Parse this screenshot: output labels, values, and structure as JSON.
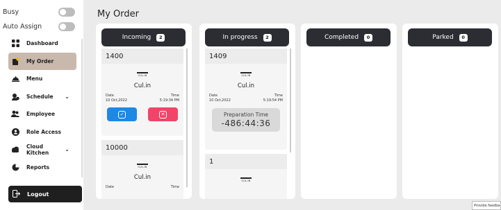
{
  "sidebar": {
    "busy_label": "Busy",
    "auto_assign_label": "Auto Assign",
    "items": [
      {
        "label": "Dashboard",
        "icon": "grid-icon",
        "active": false,
        "chevron": false
      },
      {
        "label": "My Order",
        "icon": "order-icon",
        "active": true,
        "chevron": false
      },
      {
        "label": "Menu",
        "icon": "cloche-icon",
        "active": false,
        "chevron": false
      },
      {
        "label": "Schedule",
        "icon": "schedule-icon",
        "active": false,
        "chevron": true
      },
      {
        "label": "Employee",
        "icon": "people-icon",
        "active": false,
        "chevron": false
      },
      {
        "label": "Role Access",
        "icon": "role-icon",
        "active": false,
        "chevron": false
      },
      {
        "label": "Cloud Kitchen",
        "icon": "cloud-icon",
        "active": false,
        "chevron": true
      },
      {
        "label": "Reports",
        "icon": "reports-icon",
        "active": false,
        "chevron": false
      }
    ],
    "logout_label": "Logout"
  },
  "main": {
    "title": "My Order",
    "columns": [
      {
        "label": "Incoming",
        "count": "2"
      },
      {
        "label": "In progress",
        "count": "2"
      },
      {
        "label": "Completed",
        "count": "0"
      },
      {
        "label": "Parked",
        "count": "0"
      }
    ],
    "incoming_orders": [
      {
        "id": "1400",
        "logo_text": "CUL-IN",
        "brand": "Cul.in",
        "date_label": "Date",
        "date": "10 Oct,2022",
        "time_label": "Time",
        "time": "5:19:34 PM"
      },
      {
        "id": "10000",
        "logo_text": "CUL-IN",
        "brand": "Cul.in",
        "date_label": "Date",
        "time_label": "Time"
      }
    ],
    "in_progress_orders": [
      {
        "id": "1409",
        "logo_text": "CUL-IN",
        "brand": "Cul.in",
        "date_label": "Date",
        "date": "10 Oct,2022",
        "time_label": "Time",
        "time": "5:19:54 PM",
        "prep_label": "Preparation Time",
        "prep_value": "-486:44:36"
      },
      {
        "id": "1",
        "logo_text": "CUL-IN"
      }
    ]
  },
  "feedback_label": "Provide feedback",
  "colors": {
    "accept": "#1e88e5",
    "reject": "#f04469",
    "header": "#2b2d33",
    "active_item": "#c9b8ac"
  }
}
